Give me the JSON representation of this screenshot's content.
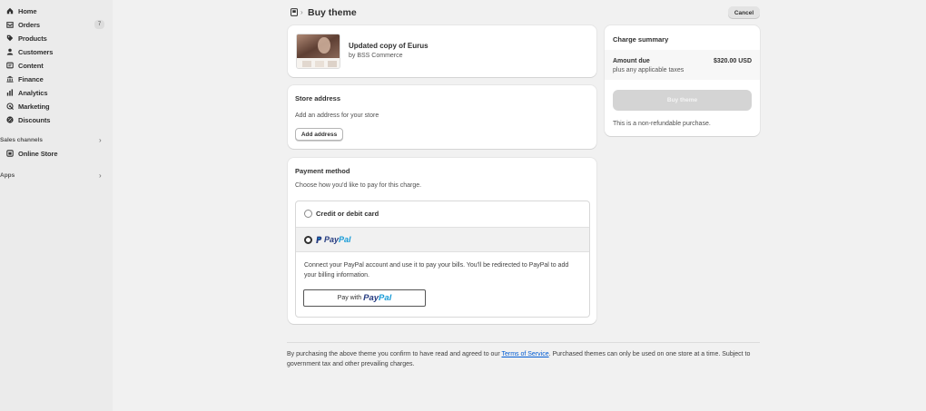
{
  "sidebar": {
    "items": [
      {
        "label": "Home",
        "icon": "home-icon"
      },
      {
        "label": "Orders",
        "icon": "orders-icon",
        "badge": "7"
      },
      {
        "label": "Products",
        "icon": "tag-icon"
      },
      {
        "label": "Customers",
        "icon": "person-icon"
      },
      {
        "label": "Content",
        "icon": "content-icon"
      },
      {
        "label": "Finance",
        "icon": "bank-icon"
      },
      {
        "label": "Analytics",
        "icon": "chart-icon"
      },
      {
        "label": "Marketing",
        "icon": "target-icon"
      },
      {
        "label": "Discounts",
        "icon": "discount-icon"
      }
    ],
    "sales_channels": {
      "label": "Sales channels",
      "items": [
        {
          "label": "Online Store",
          "icon": "store-icon"
        }
      ]
    },
    "apps": {
      "label": "Apps"
    }
  },
  "header": {
    "title": "Buy theme",
    "cancel_label": "Cancel"
  },
  "theme": {
    "name": "Updated copy of Eurus",
    "author": "by BSS Commerce"
  },
  "store_address": {
    "heading": "Store address",
    "description": "Add an address for your store",
    "button_label": "Add address"
  },
  "payment": {
    "heading": "Payment method",
    "description": "Choose how you'd like to pay for this charge.",
    "options": [
      {
        "label": "Credit or debit card",
        "selected": false
      },
      {
        "label": "PayPal",
        "selected": true
      }
    ],
    "paypal_dark": "Pay",
    "paypal_light": "Pal",
    "paypal_description": "Connect your PayPal account and use it to pay your bills. You'll be redirected to PayPal to add your billing information.",
    "paypal_button_prefix": "Pay with"
  },
  "summary": {
    "title": "Charge summary",
    "amount_label": "Amount due",
    "amount_value": "$320.00 USD",
    "tax_note": "plus any applicable taxes",
    "buy_label": "Buy theme",
    "refund_note": "This is a non-refundable purchase."
  },
  "legal": {
    "before": "By purchasing the above theme you confirm to have read and agreed to our ",
    "link": "Terms of Service",
    "after": ". Purchased themes can only be used on one store at a time. Subject to government tax and other prevailing charges."
  },
  "colors": {
    "accent_link": "#005bd3",
    "paypal_dark": "#253b80",
    "paypal_light": "#179bd7",
    "page_bg": "#f1f1f1",
    "sidebar_bg": "#ebebeb"
  }
}
